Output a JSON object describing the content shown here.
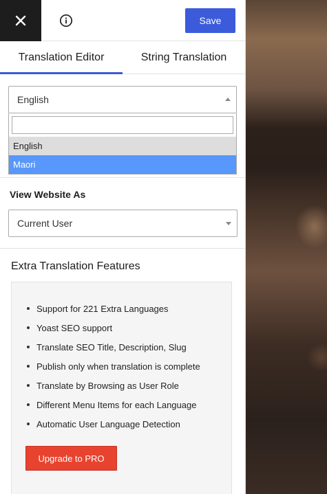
{
  "topbar": {
    "close_icon": "close-icon",
    "info_icon": "info-icon",
    "save_label": "Save"
  },
  "tabs": [
    {
      "label": "Translation Editor",
      "active": true
    },
    {
      "label": "String Translation",
      "active": false
    }
  ],
  "language_select": {
    "value": "English",
    "search_value": "",
    "options": [
      {
        "label": "English",
        "state": "selected"
      },
      {
        "label": "Maori",
        "state": "highlighted"
      }
    ]
  },
  "view_as": {
    "label": "View Website As",
    "value": "Current User"
  },
  "extra_features": {
    "title": "Extra Translation Features",
    "items": [
      "Support for 221 Extra Languages",
      "Yoast SEO support",
      "Translate SEO Title, Description, Slug",
      "Publish only when translation is complete",
      "Translate by Browsing as User Role",
      "Different Menu Items for each Language",
      "Automatic User Language Detection"
    ],
    "upgrade_label": "Upgrade to PRO"
  },
  "colors": {
    "accent": "#3b5bdb",
    "upgrade": "#e8432e",
    "highlight": "#5897fb",
    "close_bg": "#1d1d1d"
  }
}
